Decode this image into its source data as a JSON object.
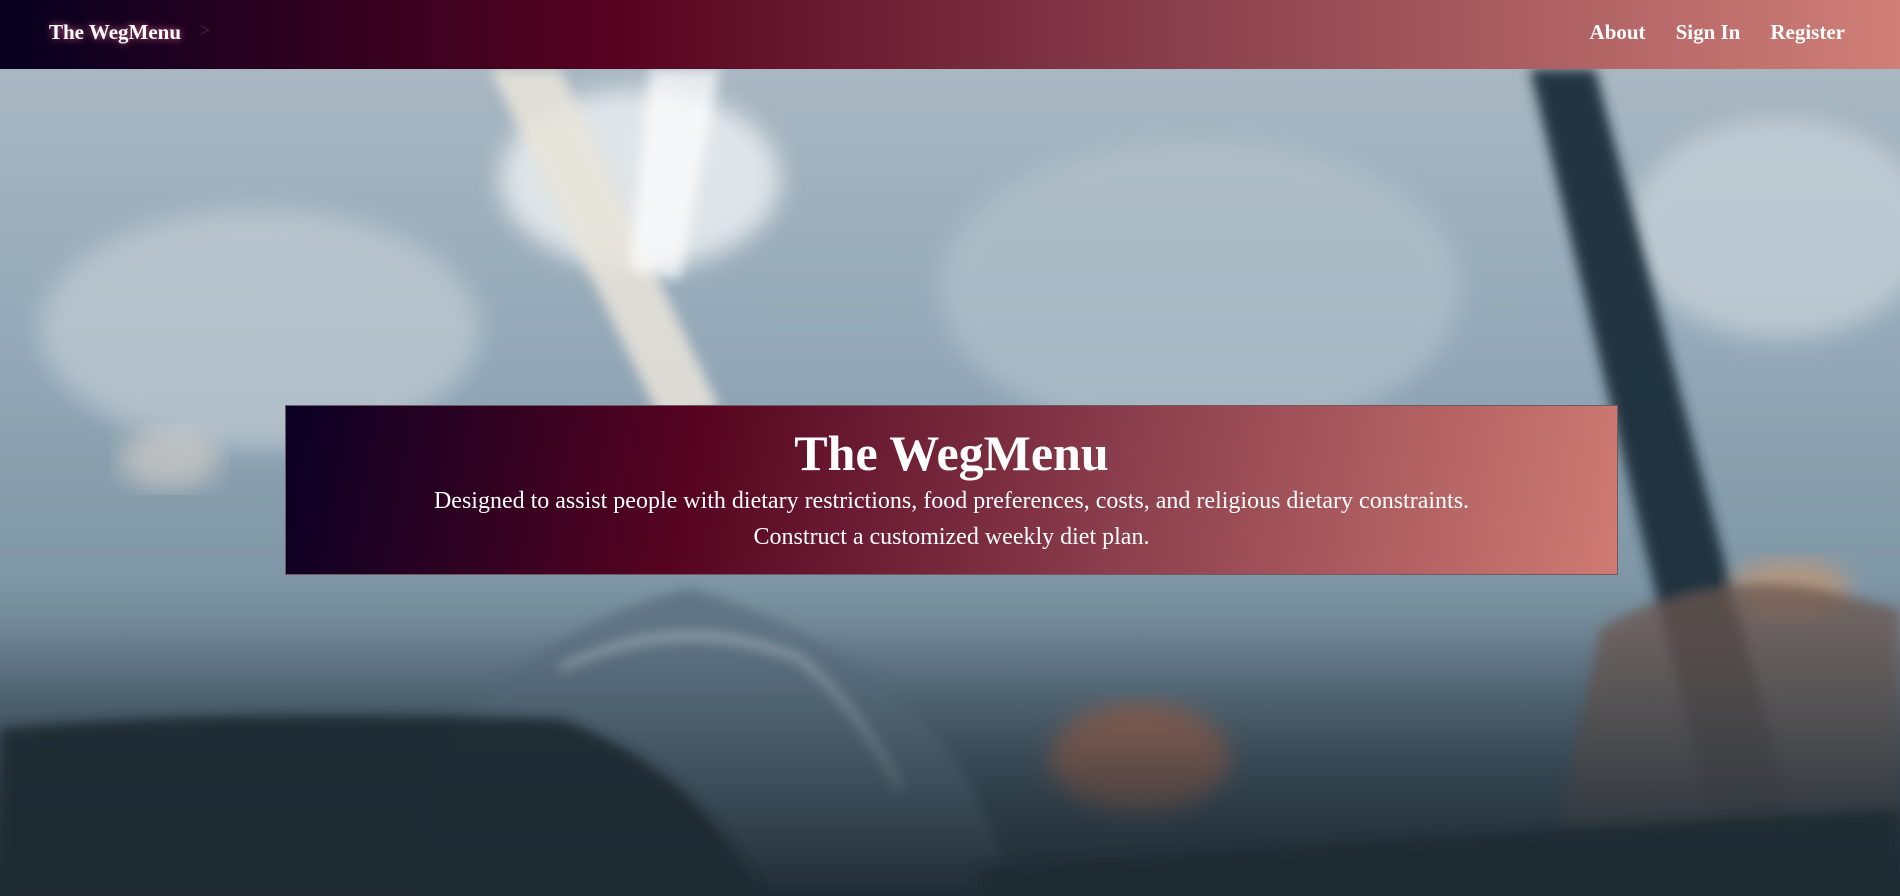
{
  "navbar": {
    "brand": "The WegMenu",
    "toggle_glyph": ">",
    "links": [
      "About",
      "Sign In",
      "Register"
    ]
  },
  "hero": {
    "title": "The WegMenu",
    "line1": "Designed to assist people with dietary restrictions, food preferences, costs, and religious dietary constraints.",
    "line2": "Construct a customized weekly diet plan."
  },
  "colors": {
    "gradient_start": "#07001f",
    "gradient_mid": "#55021f",
    "gradient_end": "#d07f77",
    "text": "#ffffff"
  }
}
